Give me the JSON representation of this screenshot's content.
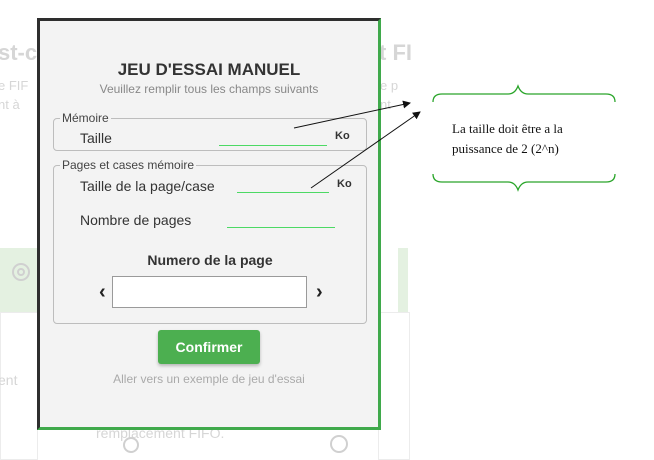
{
  "background": {
    "frag_left_1": "st-c",
    "frag_left_2": "e FIF",
    "frag_left_3": "nt à",
    "frag_left_4": "ent",
    "frag_right_1": "t FI",
    "frag_right_2": "e p",
    "frag_right_3": "nt",
    "frag_bottom": "remplacement FIFO."
  },
  "modal": {
    "title": "JEU D'ESSAI MANUEL",
    "subtitle": "Veuillez remplir tous les champs suivants",
    "memory": {
      "legend": "Mémoire",
      "size_label": "Taille",
      "size_value": "",
      "unit": "Ko"
    },
    "pages": {
      "legend": "Pages et cases mémoire",
      "page_size_label": "Taille de la page/case",
      "page_size_value": "",
      "page_size_unit": "Ko",
      "page_count_label": "Nombre de pages",
      "page_count_value": "",
      "page_number_title": "Numero de la page",
      "prev_arrow": "‹",
      "next_arrow": "›",
      "page_number_value": ""
    },
    "confirm_label": "Confirmer",
    "example_link": "Aller vers un exemple de jeu d'essai"
  },
  "annotation": {
    "text": "La taille doit être a la puissance de 2 (2^n)"
  },
  "colors": {
    "accent": "#4caf50",
    "frame": "#3fa94b",
    "input_line": "#4cd964",
    "callout": "#2aa52a"
  }
}
